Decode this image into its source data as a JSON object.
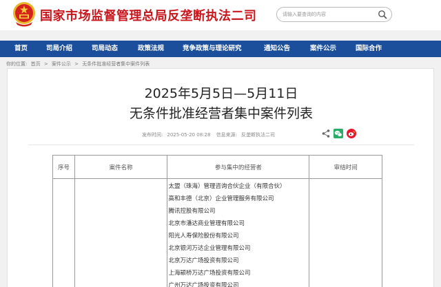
{
  "header": {
    "site_title": "国家市场监督管理总局反垄断执法二司",
    "search_placeholder": "请输入要查询的内容"
  },
  "nav": {
    "items": [
      "首页",
      "司局介绍",
      "司局动态",
      "政策法规",
      "竞争政策与理论研究",
      "通知公告",
      "案件公示",
      "国际合作"
    ]
  },
  "breadcrumb": {
    "prefix": "你的位置:",
    "items": [
      "首页",
      ">",
      "案件公示",
      ">",
      "无条件批准经营者集中案件列表"
    ]
  },
  "article": {
    "title_line1": "2025年5月5日—5月11日",
    "title_line2": "无条件批准经营者集中案件列表",
    "publish_label": "发布时间:",
    "publish_time": "2025-05-20 08:28",
    "source_label": "信息来源:",
    "source": "反垄断执法二司"
  },
  "share": {
    "icons": [
      "share-icon",
      "wechat-icon",
      "weibo-icon"
    ],
    "colors": {
      "wechat": "#2aae67",
      "weibo": "#e6162d"
    }
  },
  "table": {
    "headers": [
      "序号",
      "案件名称",
      "参与集中的经营者",
      "审结时间"
    ],
    "companies": [
      "太盟（珠海）管理咨询合伙企业（有限合伙）",
      "高和丰德（北京）企业管理服务有限公司",
      "腾讯控股有限公司",
      "北京市潘达商业管理有限公司",
      "阳光人寿保险股份有限公司",
      "北京银河万达企业管理有限公司",
      "北京万达广场投资有限公司",
      "上海颛桥万达广场投资有限公司",
      "广州万达广场投资有限公司"
    ]
  },
  "colors": {
    "title_red": "#c8161d",
    "nav_blue": "#1b4f9c"
  }
}
